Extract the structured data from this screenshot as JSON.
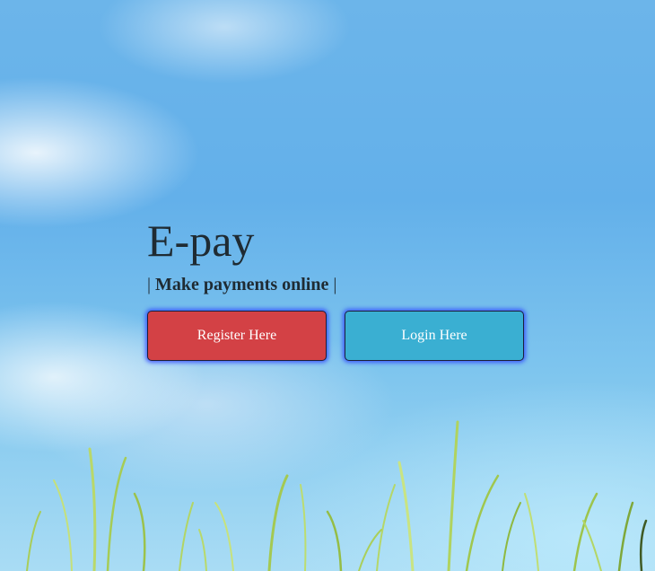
{
  "hero": {
    "title": "E-pay",
    "tagline_prefix": "|",
    "tagline": "Make payments online",
    "tagline_suffix": "|"
  },
  "actions": {
    "register_label": "Register Here",
    "login_label": "Login Here"
  },
  "colors": {
    "register_button": "#d34145",
    "login_button": "#3aafd2",
    "button_glow": "#2838ff",
    "text": "#1f2b33"
  }
}
